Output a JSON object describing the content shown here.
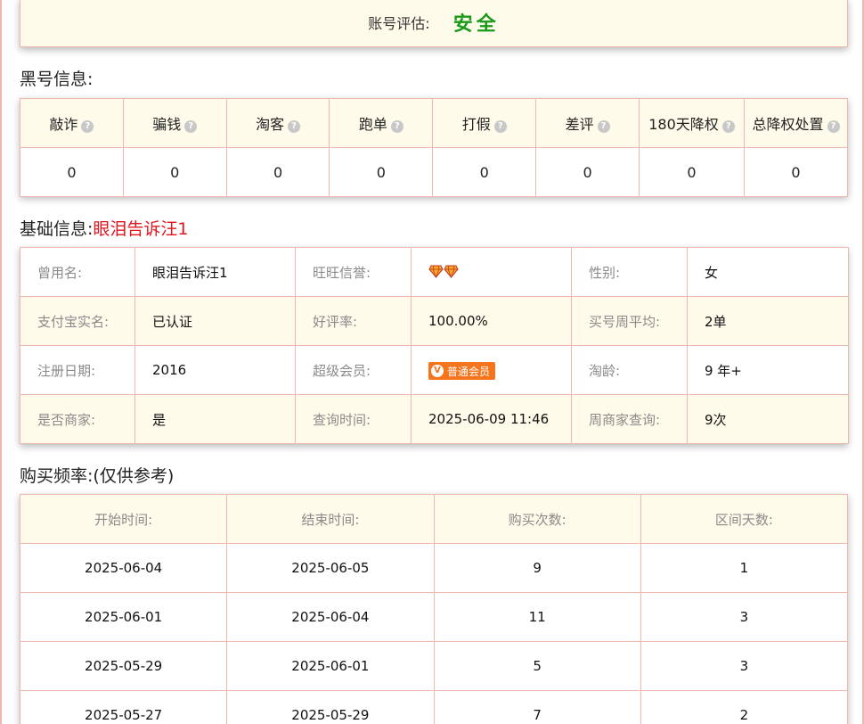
{
  "assessment": {
    "label": "账号评估:",
    "value": "安全"
  },
  "black_info": {
    "title": "黑号信息:",
    "headers": [
      "敲诈",
      "骗钱",
      "淘客",
      "跑单",
      "打假",
      "差评",
      "180天降权",
      "总降权处置"
    ],
    "values": [
      "0",
      "0",
      "0",
      "0",
      "0",
      "0",
      "0",
      "0"
    ],
    "help_glyph": "?"
  },
  "basic_info": {
    "title": "基础信息:",
    "account_name": "眼泪告诉汪1",
    "rows": [
      [
        {
          "label": "曾用名:",
          "value": "眼泪告诉汪1"
        },
        {
          "label": "旺旺信誉:",
          "value": ""
        },
        {
          "label": "性别:",
          "value": "女"
        }
      ],
      [
        {
          "label": "支付宝实名:",
          "value": "已认证"
        },
        {
          "label": "好评率:",
          "value": "100.00%"
        },
        {
          "label": "买号周平均:",
          "value": "2单"
        }
      ],
      [
        {
          "label": "注册日期:",
          "value": "2016"
        },
        {
          "label": "超级会员:",
          "value": ""
        },
        {
          "label": "淘龄:",
          "value": "9 年+"
        }
      ],
      [
        {
          "label": "是否商家:",
          "value": "是"
        },
        {
          "label": "查询时间:",
          "value": "2025-06-09 11:46"
        },
        {
          "label": "周商家查询:",
          "value": "9次"
        }
      ]
    ],
    "credit_icon": "diamond-icon",
    "credit_diamonds": 2,
    "vip_badge": {
      "glyph": "V",
      "label": "普通会员",
      "color": "#f5741c"
    }
  },
  "frequency": {
    "title": "购买频率:(仅供参考)",
    "headers": [
      "开始时间:",
      "结束时间:",
      "购买次数:",
      "区间天数:"
    ],
    "rows": [
      [
        "2025-06-04",
        "2025-06-05",
        "9",
        "1"
      ],
      [
        "2025-06-01",
        "2025-06-04",
        "11",
        "3"
      ],
      [
        "2025-05-29",
        "2025-06-01",
        "5",
        "3"
      ],
      [
        "2025-05-27",
        "2025-05-29",
        "7",
        "2"
      ]
    ]
  },
  "colors": {
    "border": "#f0b7b0",
    "header_bg": "#fffbea",
    "safe_green": "#1a9a1a",
    "accent_red": "#e0141e"
  }
}
